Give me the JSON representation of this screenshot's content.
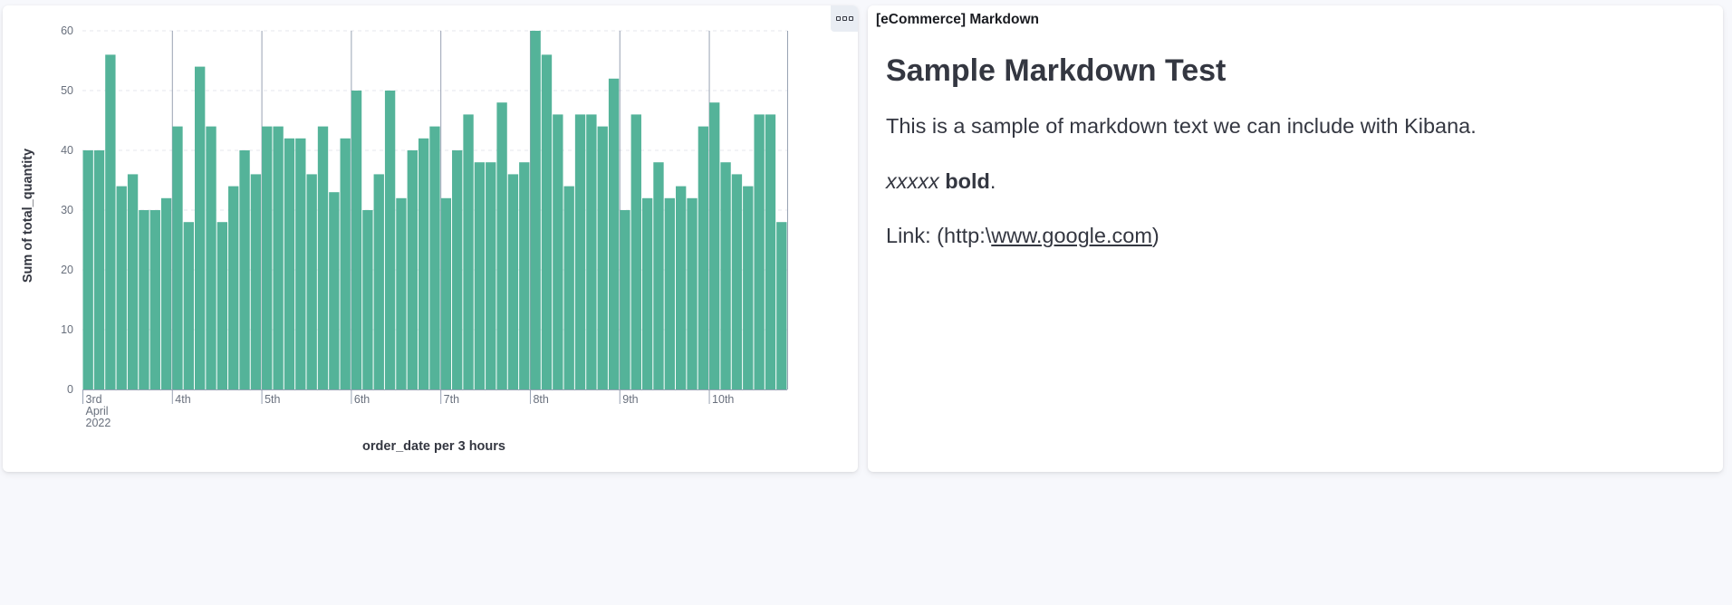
{
  "panel_chart": {
    "options_icon": "box-menu-icon"
  },
  "panel_markdown": {
    "title": "[eCommerce] Markdown",
    "heading": "Sample Markdown Test",
    "paragraph": "This is a sample of markdown text we can include with Kibana.",
    "italic_text": "xxxxx",
    "bold_text": "bold",
    "bold_suffix": ".",
    "link_prefix": "Link: (http:\\",
    "link_text": "www.google.com",
    "link_suffix": ")"
  },
  "chart_data": {
    "type": "bar",
    "title": "",
    "xlabel": "order_date per 3 hours",
    "ylabel": "Sum of total_quantity",
    "ylim": [
      0,
      60
    ],
    "yticks": [
      0,
      10,
      20,
      30,
      40,
      50,
      60
    ],
    "grid": true,
    "bar_color": "#54b399",
    "x_start": "2022-04-03 00:00",
    "interval": "3 hours",
    "x_tick_labels": [
      {
        "slot": 0,
        "lines": [
          "3rd",
          "April",
          "2022"
        ]
      },
      {
        "slot": 8,
        "lines": [
          "4th"
        ]
      },
      {
        "slot": 16,
        "lines": [
          "5th"
        ]
      },
      {
        "slot": 24,
        "lines": [
          "6th"
        ]
      },
      {
        "slot": 32,
        "lines": [
          "7th"
        ]
      },
      {
        "slot": 40,
        "lines": [
          "8th"
        ]
      },
      {
        "slot": 48,
        "lines": [
          "9th"
        ]
      },
      {
        "slot": 56,
        "lines": [
          "10th"
        ]
      }
    ],
    "values": [
      40,
      40,
      56,
      34,
      36,
      30,
      30,
      32,
      44,
      28,
      54,
      44,
      28,
      34,
      40,
      36,
      44,
      44,
      42,
      42,
      36,
      44,
      33,
      42,
      50,
      30,
      36,
      50,
      32,
      40,
      42,
      44,
      32,
      40,
      46,
      38,
      38,
      48,
      36,
      38,
      60,
      56,
      46,
      34,
      46,
      46,
      44,
      52,
      30,
      46,
      32,
      38,
      32,
      34,
      32,
      44,
      48,
      38,
      36,
      34,
      46,
      46,
      28
    ]
  }
}
